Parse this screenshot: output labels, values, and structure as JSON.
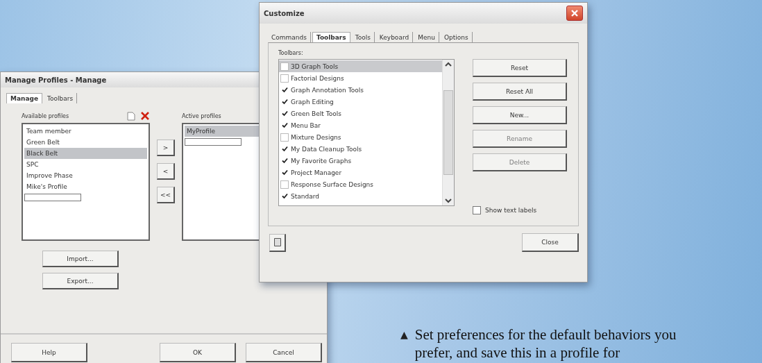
{
  "manage_window": {
    "title": "Manage Profiles - Manage",
    "tabs": [
      {
        "label": "Manage",
        "selected": true
      },
      {
        "label": "Toolbars",
        "selected": false
      }
    ],
    "available_label": "Available profiles",
    "available": [
      {
        "label": "Team member",
        "selected": false
      },
      {
        "label": "Green Belt",
        "selected": false
      },
      {
        "label": "Black Belt",
        "selected": true
      },
      {
        "label": "SPC",
        "selected": false
      },
      {
        "label": "Improve Phase",
        "selected": false
      },
      {
        "label": "Mike's Profile",
        "selected": false
      }
    ],
    "move_buttons": [
      ">",
      "<",
      "<<"
    ],
    "active_label": "Active profiles",
    "active": [
      {
        "label": "MyProfile",
        "selected": true
      }
    ],
    "side_buttons": [
      "Import...",
      "Export..."
    ],
    "footer_buttons": [
      "Help",
      "OK",
      "Cancel"
    ]
  },
  "customize_window": {
    "title": "Customize",
    "tabs": [
      {
        "label": "Commands",
        "selected": false
      },
      {
        "label": "Toolbars",
        "selected": true
      },
      {
        "label": "Tools",
        "selected": false
      },
      {
        "label": "Keyboard",
        "selected": false
      },
      {
        "label": "Menu",
        "selected": false
      },
      {
        "label": "Options",
        "selected": false
      }
    ],
    "toolbars_label": "Toolbars:",
    "toolbars": [
      {
        "label": "3D Graph Tools",
        "checked": false,
        "selected": true
      },
      {
        "label": "Factorial Designs",
        "checked": false,
        "selected": false
      },
      {
        "label": "Graph Annotation Tools",
        "checked": true,
        "selected": false
      },
      {
        "label": "Graph Editing",
        "checked": true,
        "selected": false
      },
      {
        "label": "Green Belt Tools",
        "checked": true,
        "selected": false
      },
      {
        "label": "Menu Bar",
        "checked": true,
        "selected": false
      },
      {
        "label": "Mixture Designs",
        "checked": false,
        "selected": false
      },
      {
        "label": "My Data Cleanup Tools",
        "checked": true,
        "selected": false
      },
      {
        "label": "My Favorite Graphs",
        "checked": true,
        "selected": false
      },
      {
        "label": "Project Manager",
        "checked": true,
        "selected": false
      },
      {
        "label": "Response Surface Designs",
        "checked": false,
        "selected": false
      },
      {
        "label": "Standard",
        "checked": true,
        "selected": false
      }
    ],
    "buttons": [
      {
        "label": "Reset",
        "disabled": false
      },
      {
        "label": "Reset All",
        "disabled": false
      },
      {
        "label": "New...",
        "disabled": false
      },
      {
        "label": "Rename",
        "disabled": true
      },
      {
        "label": "Delete",
        "disabled": true
      }
    ],
    "show_text_labels": {
      "label": "Show text labels",
      "checked": false
    },
    "close_button": "Close"
  },
  "caption": {
    "marker": "▲",
    "text": "Set preferences for the default behaviors you prefer, and save this in a profile for"
  }
}
